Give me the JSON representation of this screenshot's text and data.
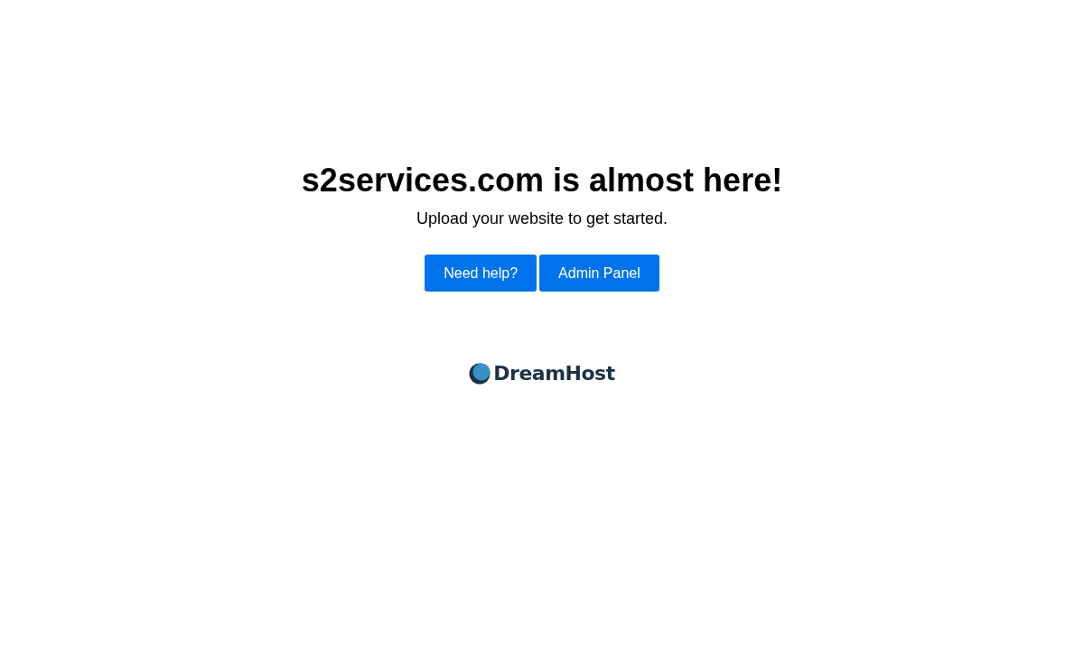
{
  "heading": "s2services.com is almost here!",
  "subtitle": "Upload your website to get started.",
  "buttons": [
    "Need help?",
    "Admin Panel"
  ],
  "logo": {
    "text": "DreamHost"
  }
}
